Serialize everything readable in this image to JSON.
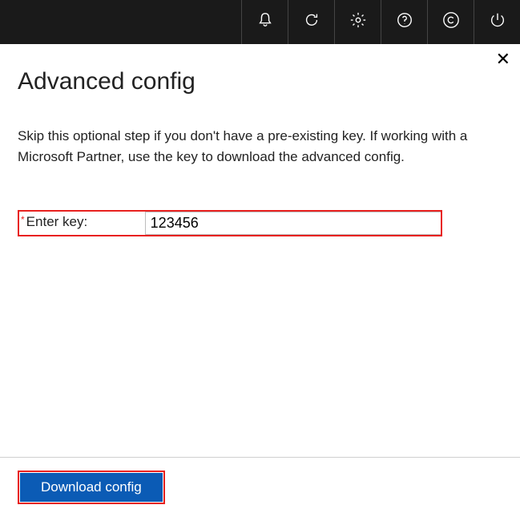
{
  "header": {
    "icons": {
      "notifications": "bell-icon",
      "refresh": "refresh-icon",
      "settings": "gear-icon",
      "help": "help-icon",
      "copyright": "copyright-icon",
      "power": "power-icon"
    }
  },
  "panel": {
    "title": "Advanced config",
    "description": "Skip this optional step if you don't have a pre-existing key. If working with a Microsoft Partner, use the key to download the advanced config.",
    "field": {
      "required_mark": "*",
      "label": "Enter key:",
      "value": "123456"
    },
    "button": {
      "download": "Download config"
    }
  }
}
